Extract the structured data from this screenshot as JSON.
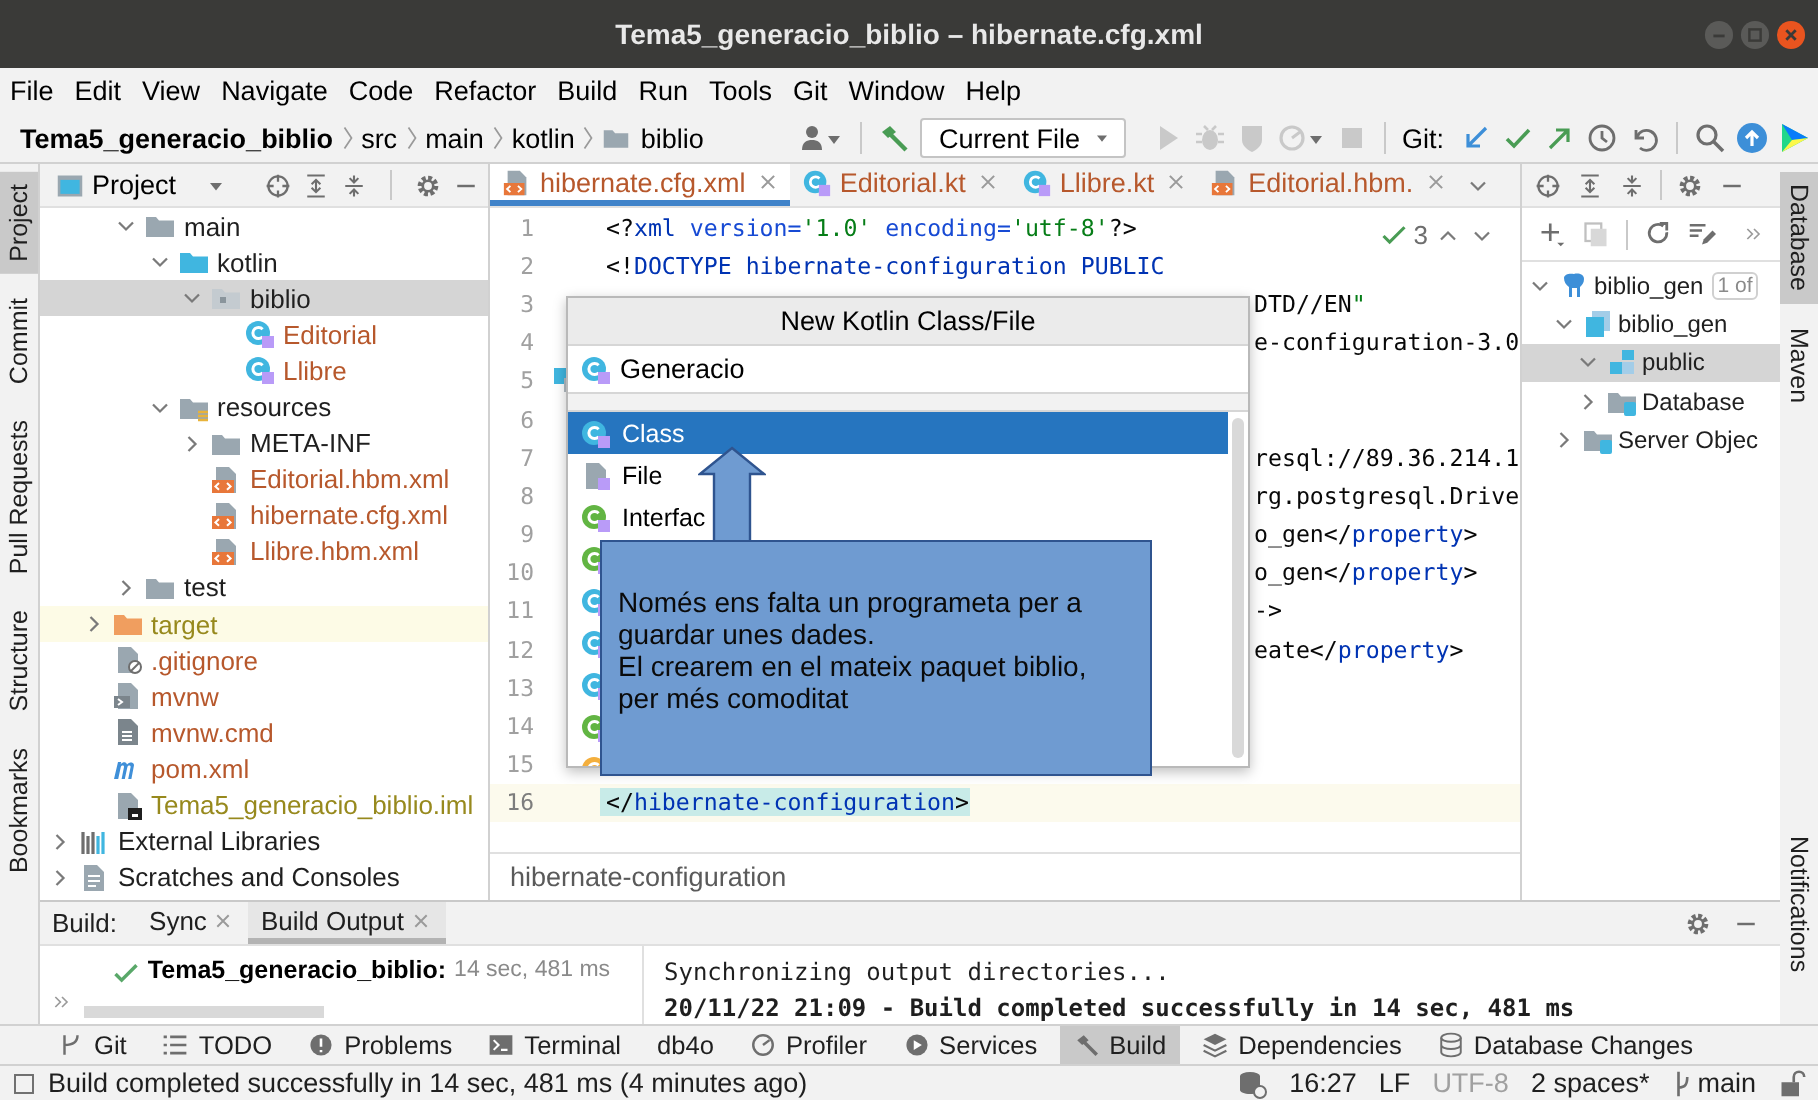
{
  "window": {
    "title": "Tema5_generacio_biblio – hibernate.cfg.xml"
  },
  "menu": [
    "File",
    "Edit",
    "View",
    "Navigate",
    "Code",
    "Refactor",
    "Build",
    "Run",
    "Tools",
    "Git",
    "Window",
    "Help"
  ],
  "breadcrumb": [
    "Tema5_generacio_biblio",
    "src",
    "main",
    "kotlin",
    "biblio"
  ],
  "toolbar": {
    "run_config": "Current File",
    "git_label": "Git:"
  },
  "left_strip": [
    {
      "label": "Project",
      "selected": true
    },
    {
      "label": "Commit",
      "selected": false
    },
    {
      "label": "Pull Requests",
      "selected": false
    },
    {
      "label": "Structure",
      "selected": false
    },
    {
      "label": "Bookmarks",
      "selected": false
    }
  ],
  "project": {
    "title": "Project",
    "tree": [
      {
        "children": [
          {
            "children": [
              {
                "label": "main",
                "kind": "folder",
                "color": "#1f1f1f",
                "selected": false,
                "expanded": true,
                "children": [
                  {
                    "label": "kotlin",
                    "kind": "source-folder",
                    "color": "#1f1f1f",
                    "selected": false,
                    "expanded": true,
                    "children": [
                      {
                        "label": "biblio",
                        "kind": "package",
                        "color": "#1f1f1f",
                        "selected": true,
                        "expanded": true,
                        "children": [
                          {
                            "label": "Editorial",
                            "kind": "kotlin-class",
                            "color": "#b7582c",
                            "selected": false
                          },
                          {
                            "label": "Llibre",
                            "kind": "kotlin-class",
                            "color": "#b7582c",
                            "selected": false
                          }
                        ]
                      }
                    ]
                  },
                  {
                    "label": "resources",
                    "kind": "resources-folder",
                    "color": "#1f1f1f",
                    "selected": false,
                    "expanded": true,
                    "children": [
                      {
                        "label": "META-INF",
                        "kind": "folder",
                        "color": "#1f1f1f",
                        "selected": false,
                        "expanded": false
                      },
                      {
                        "label": "Editorial.hbm.xml",
                        "kind": "xml",
                        "color": "#b7582c",
                        "selected": false
                      },
                      {
                        "label": "hibernate.cfg.xml",
                        "kind": "xml",
                        "color": "#b7582c",
                        "selected": false
                      },
                      {
                        "label": "Llibre.hbm.xml",
                        "kind": "xml",
                        "color": "#b7582c",
                        "selected": false
                      }
                    ]
                  }
                ]
              },
              {
                "label": "test",
                "kind": "folder",
                "color": "#1f1f1f",
                "selected": false,
                "expanded": false
              }
            ]
          },
          {
            "label": "target",
            "kind": "excluded-folder",
            "color": "#97891d",
            "selected": false,
            "expanded": false
          },
          {
            "label": ".gitignore",
            "kind": "gitignore",
            "color": "#b7582c",
            "selected": false
          },
          {
            "label": "mvnw",
            "kind": "script",
            "color": "#b7582c",
            "selected": false
          },
          {
            "label": "mvnw.cmd",
            "kind": "cmd",
            "color": "#b7582c",
            "selected": false
          },
          {
            "label": "pom.xml",
            "kind": "maven",
            "color": "#b7582c",
            "selected": false
          },
          {
            "label": "Tema5_generacio_biblio.iml",
            "kind": "iml",
            "color": "#97891d",
            "selected": false
          }
        ]
      },
      {
        "label": "External Libraries",
        "kind": "libraries",
        "color": "#1f1f1f",
        "selected": false,
        "expanded": false
      },
      {
        "label": "Scratches and Consoles",
        "kind": "scratches",
        "color": "#1f1f1f",
        "selected": false,
        "expanded": false
      }
    ]
  },
  "editor": {
    "tabs": [
      {
        "label": "hibernate.cfg.xml",
        "kind": "xml",
        "color": "#b7582c",
        "selected": true
      },
      {
        "label": "Editorial.kt",
        "kind": "kotlin-class",
        "color": "#b7582c",
        "selected": false
      },
      {
        "label": "Llibre.kt",
        "kind": "kotlin-class",
        "color": "#b7582c",
        "selected": false
      },
      {
        "label": "Editorial.hbm.",
        "kind": "xml",
        "color": "#b7582c",
        "selected": false
      }
    ],
    "problems": "3",
    "lines": [
      {
        "number": "1",
        "kind": "full",
        "current": false,
        "text": "<?xml version='1.0' encoding='utf-8'?>"
      },
      {
        "number": "2",
        "kind": "full",
        "current": false,
        "text": "<!DOCTYPE hibernate-configuration PUBLIC"
      },
      {
        "number": "3",
        "kind": "clipped",
        "current": false,
        "text": "DTD//EN\""
      },
      {
        "number": "4",
        "kind": "clipped",
        "current": false,
        "text": "e-configuration-3.0"
      },
      {
        "number": "5",
        "kind": "hidden",
        "current": false,
        "mark": true
      },
      {
        "number": "6",
        "kind": "hidden",
        "current": false
      },
      {
        "number": "7",
        "kind": "clipped",
        "current": false,
        "text": "resql://89.36.214.1"
      },
      {
        "number": "8",
        "kind": "clipped",
        "current": false,
        "text": "rg.postgresql.Drive"
      },
      {
        "number": "9",
        "kind": "clipped",
        "current": false,
        "text": "o_gen</property>"
      },
      {
        "number": "10",
        "kind": "clipped",
        "current": false,
        "text": "o_gen</property>"
      },
      {
        "number": "11",
        "kind": "clipped",
        "current": false,
        "text": "->"
      },
      {
        "number": "12",
        "kind": "clipped",
        "current": false,
        "text": "eate</property>"
      },
      {
        "number": "13",
        "kind": "hidden",
        "current": false
      },
      {
        "number": "14",
        "kind": "hidden",
        "current": false
      },
      {
        "number": "15",
        "kind": "hidden",
        "current": false
      },
      {
        "number": "16",
        "kind": "full",
        "current": true,
        "text": "</hibernate-configuration>"
      }
    ],
    "breadcrumb": "hibernate-configuration"
  },
  "popup": {
    "title": "New Kotlin Class/File",
    "value": "Generacio",
    "items": [
      {
        "kind": "class",
        "label": "Class",
        "selected": true
      },
      {
        "kind": "file",
        "label": "File",
        "selected": false
      },
      {
        "kind": "interface",
        "label": "Interfac",
        "selected": false
      },
      {
        "kind": "interface",
        "selected": false
      },
      {
        "kind": "class",
        "selected": false
      },
      {
        "kind": "enum",
        "selected": false
      },
      {
        "kind": "class",
        "selected": false
      },
      {
        "kind": "annotation",
        "selected": false
      },
      {
        "kind": "object",
        "selected": false
      }
    ]
  },
  "callout": {
    "paragraphs": [
      "Només ens falta un programeta per a guardar unes dades.",
      "El crearem en el mateix paquet biblio, per més comoditat"
    ]
  },
  "database": {
    "tree": [
      {
        "label": "biblio_gen",
        "kind": "datasource",
        "badge": "1 of",
        "selected": false,
        "expanded": true,
        "children": [
          {
            "label": "biblio_gen",
            "kind": "database",
            "selected": false,
            "expanded": true,
            "children": [
              {
                "label": "public",
                "kind": "schema",
                "selected": true,
                "expanded": true
              },
              {
                "label": "Database",
                "kind": "folder",
                "selected": false,
                "expanded": false
              }
            ]
          },
          {
            "label": "Server Objec",
            "kind": "folder",
            "selected": false,
            "expanded": false
          }
        ]
      }
    ]
  },
  "right_strip": [
    {
      "label": "Database",
      "selected": true
    },
    {
      "label": "Maven",
      "selected": false
    },
    {
      "label": "Notifications",
      "selected": false
    }
  ],
  "build": {
    "label": "Build:",
    "tabs": [
      {
        "label": "Sync",
        "selected": false
      },
      {
        "label": "Build Output",
        "selected": true
      }
    ],
    "result": {
      "name": "Tema5_generacio_biblio:",
      "time": "14 sec, 481 ms",
      "success": true
    },
    "console": [
      "Synchronizing output directories...",
      "20/11/22 21:09 - Build completed successfully in 14 sec, 481 ms"
    ]
  },
  "tool_windows": [
    {
      "label": "Git",
      "kind": "git",
      "selected": false
    },
    {
      "label": "TODO",
      "kind": "todo",
      "selected": false
    },
    {
      "label": "Problems",
      "kind": "problems",
      "selected": false
    },
    {
      "label": "Terminal",
      "kind": "terminal",
      "selected": false
    },
    {
      "label": "db4o",
      "kind": "plain",
      "selected": false
    },
    {
      "label": "Profiler",
      "kind": "profiler",
      "selected": false
    },
    {
      "label": "Services",
      "kind": "services",
      "selected": false
    },
    {
      "label": "Build",
      "kind": "build",
      "selected": true
    },
    {
      "label": "Dependencies",
      "kind": "dependencies",
      "selected": false
    },
    {
      "label": "Database Changes",
      "kind": "database",
      "selected": false
    }
  ],
  "status_bar": {
    "message": "Build completed successfully in 14 sec, 481 ms (4 minutes ago)",
    "items": [
      {
        "text": "16:27",
        "kind": "text",
        "disabled": false
      },
      {
        "text": "LF",
        "kind": "text",
        "disabled": false
      },
      {
        "text": "UTF-8",
        "kind": "text",
        "disabled": true
      },
      {
        "text": "2 spaces*",
        "kind": "text",
        "disabled": false
      },
      {
        "text": "main",
        "kind": "branch",
        "disabled": false
      }
    ]
  }
}
